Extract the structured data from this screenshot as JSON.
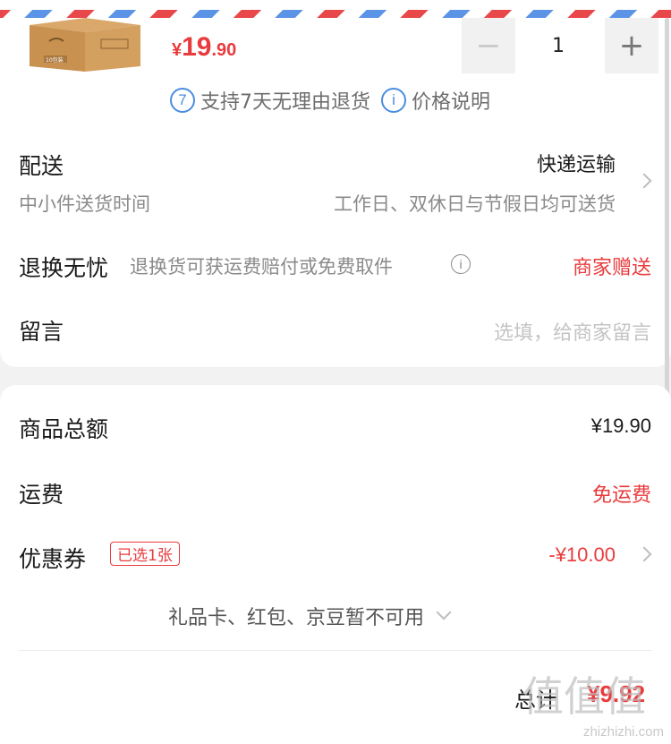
{
  "product": {
    "image_label": "10包装",
    "price": {
      "currency": "¥",
      "integer": "19",
      "decimal": ".90"
    },
    "quantity": "1",
    "minus_symbol": "−",
    "plus_symbol": "+"
  },
  "policies": [
    {
      "icon": "7",
      "text": "支持7天无理由退货"
    },
    {
      "icon": "i",
      "text": "价格说明"
    }
  ],
  "delivery": {
    "title": "配送",
    "method": "快递运输",
    "subtitle": "中小件送货时间",
    "schedule": "工作日、双休日与节假日均可送货"
  },
  "return": {
    "title": "退换无忧",
    "desc": "退换货可获运费赔付或免费取件",
    "info_icon": "i",
    "tag": "商家赠送"
  },
  "message": {
    "title": "留言",
    "placeholder": "选填，给商家留言"
  },
  "summary": {
    "goods_label": "商品总额",
    "goods_value": "¥19.90",
    "shipping_label": "运费",
    "shipping_value": "免运费",
    "coupon_label": "优惠券",
    "coupon_badge": "已选1张",
    "coupon_value": "-¥10.00",
    "unavailable": "礼品卡、红包、京豆暂不可用",
    "total_label": "总计",
    "total_value": "¥9.92"
  },
  "watermark": {
    "text": "zhizhizhi.com",
    "logo": "值值值"
  },
  "colors": {
    "accent": "#e93b3d",
    "link_blue": "#4a8de0"
  }
}
